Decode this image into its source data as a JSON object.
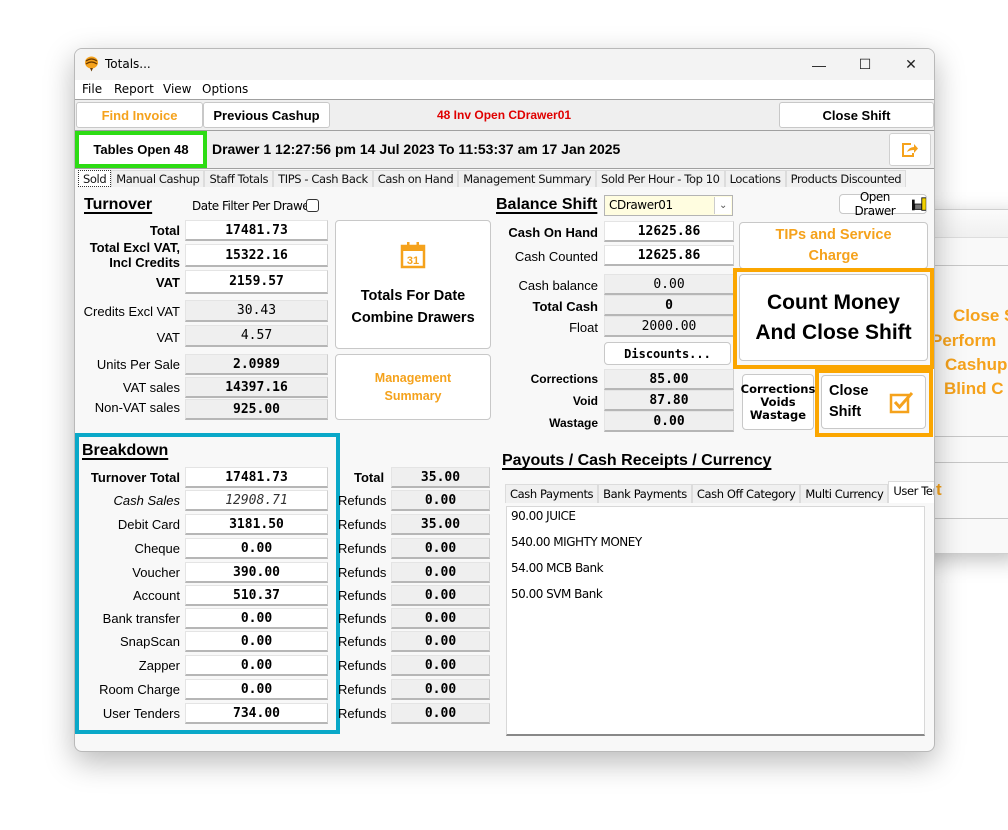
{
  "window": {
    "title": "Totals...",
    "controls": {
      "minimize": "—",
      "maximize": "☐",
      "close": "✕"
    }
  },
  "menu": [
    "File",
    "Report",
    "View",
    "Options"
  ],
  "toolbar": {
    "find_invoice": "Find Invoice",
    "previous_cashup": "Previous Cashup",
    "invoice_status": "48 Inv Open CDrawer01",
    "close_shift": "Close Shift"
  },
  "drawerbar": {
    "tables_open": "Tables Open 48",
    "drawer_info": "Drawer 1  12:27:56 pm 14 Jul 2023  To  11:53:37 am 17 Jan 2025",
    "export_icon": "export-arrow-icon"
  },
  "tabs": [
    "Sold",
    "Manual Cashup",
    "Staff Totals",
    "TIPS - Cash Back",
    "Cash on Hand",
    "Management Summary",
    "Sold Per Hour - Top 10",
    "Locations",
    "Products Discounted"
  ],
  "active_tab": "Sold",
  "turnover": {
    "title": "Turnover",
    "date_filter_label": "Date Filter Per Drawer",
    "date_filter_checked": false,
    "rows": [
      {
        "label": "Total",
        "value": "17481.73"
      },
      {
        "label": "Total Excl VAT,\nIncl Credits",
        "value": "15322.16"
      },
      {
        "label": "VAT",
        "value": "2159.57"
      },
      {
        "label": "Credits Excl VAT",
        "value": "30.43"
      },
      {
        "label": "VAT",
        "value": "4.57"
      },
      {
        "label": "Units Per Sale",
        "value": "2.0989"
      },
      {
        "label": "VAT sales",
        "value": "14397.16"
      },
      {
        "label": "Non-VAT sales",
        "value": "925.00"
      }
    ],
    "label_total_excl_1": "Total Excl VAT,",
    "label_total_excl_2": "Incl Credits"
  },
  "buttons": {
    "totals_for_date_1": "Totals For Date",
    "totals_for_date_2": "Combine Drawers",
    "management_summary_1": "Management",
    "management_summary_2": "Summary",
    "tips_1": "TIPs and Service",
    "tips_2": "Charge",
    "count_money_1": "Count Money",
    "count_money_2": "And Close Shift",
    "corrections_1": "Corrections",
    "corrections_2": "Voids",
    "corrections_3": "Wastage",
    "close_shift_1": "Close",
    "close_shift_2": "Shift",
    "open_drawer": "Open Drawer",
    "discounts": "Discounts..."
  },
  "balance": {
    "title": "Balance Shift",
    "drawer_select": "CDrawer01",
    "rows": [
      {
        "label": "Cash On Hand",
        "value": "12625.86"
      },
      {
        "label": "Cash Counted",
        "value": "12625.86"
      },
      {
        "label": "Cash balance",
        "value": "0.00"
      },
      {
        "label": "Total Cash",
        "value": "0"
      },
      {
        "label": "Float",
        "value": "2000.00"
      },
      {
        "label": "Corrections",
        "value": "85.00"
      },
      {
        "label": "Void",
        "value": "87.80"
      },
      {
        "label": "Wastage",
        "value": "0.00"
      }
    ]
  },
  "breakdown": {
    "title": "Breakdown",
    "rows": [
      {
        "label": "Turnover Total",
        "value": "17481.73",
        "refund_label": "Total",
        "refund": "35.00"
      },
      {
        "label": "Cash Sales",
        "value": "12908.71",
        "refund_label": "Refunds",
        "refund": "0.00"
      },
      {
        "label": "Debit Card",
        "value": "3181.50",
        "refund_label": "Refunds",
        "refund": "35.00"
      },
      {
        "label": "Cheque",
        "value": "0.00",
        "refund_label": "Refunds",
        "refund": "0.00"
      },
      {
        "label": "Voucher",
        "value": "390.00",
        "refund_label": "Refunds",
        "refund": "0.00"
      },
      {
        "label": "Account",
        "value": "510.37",
        "refund_label": "Refunds",
        "refund": "0.00"
      },
      {
        "label": "Bank transfer",
        "value": "0.00",
        "refund_label": "Refunds",
        "refund": "0.00"
      },
      {
        "label": "SnapScan",
        "value": "0.00",
        "refund_label": "Refunds",
        "refund": "0.00"
      },
      {
        "label": "Zapper",
        "value": "0.00",
        "refund_label": "Refunds",
        "refund": "0.00"
      },
      {
        "label": "Room Charge",
        "value": "0.00",
        "refund_label": "Refunds",
        "refund": "0.00"
      },
      {
        "label": "User Tenders",
        "value": "734.00",
        "refund_label": "Refunds",
        "refund": "0.00"
      }
    ]
  },
  "payouts": {
    "title": "Payouts / Cash Receipts / Currency",
    "tabs": [
      "Cash Payments",
      "Bank Payments",
      "Cash Off Category",
      "Multi Currency",
      "User Tenders"
    ],
    "active_tab": "User Tenders",
    "items": [
      "90.00 JUICE",
      "540.00 MIGHTY MONEY",
      "54.00 MCB Bank",
      "50.00 SVM Bank"
    ]
  },
  "background_dialog": {
    "lines": [
      "Close S",
      "Perform",
      "Cashup",
      "Blind C"
    ],
    "partial": "t"
  },
  "colors": {
    "accent_orange": "#f5a21c",
    "highlight_orange": "#fba600",
    "highlight_green": "#2ddc14",
    "highlight_blue": "#0aa8c8",
    "status_red": "#e00000"
  }
}
